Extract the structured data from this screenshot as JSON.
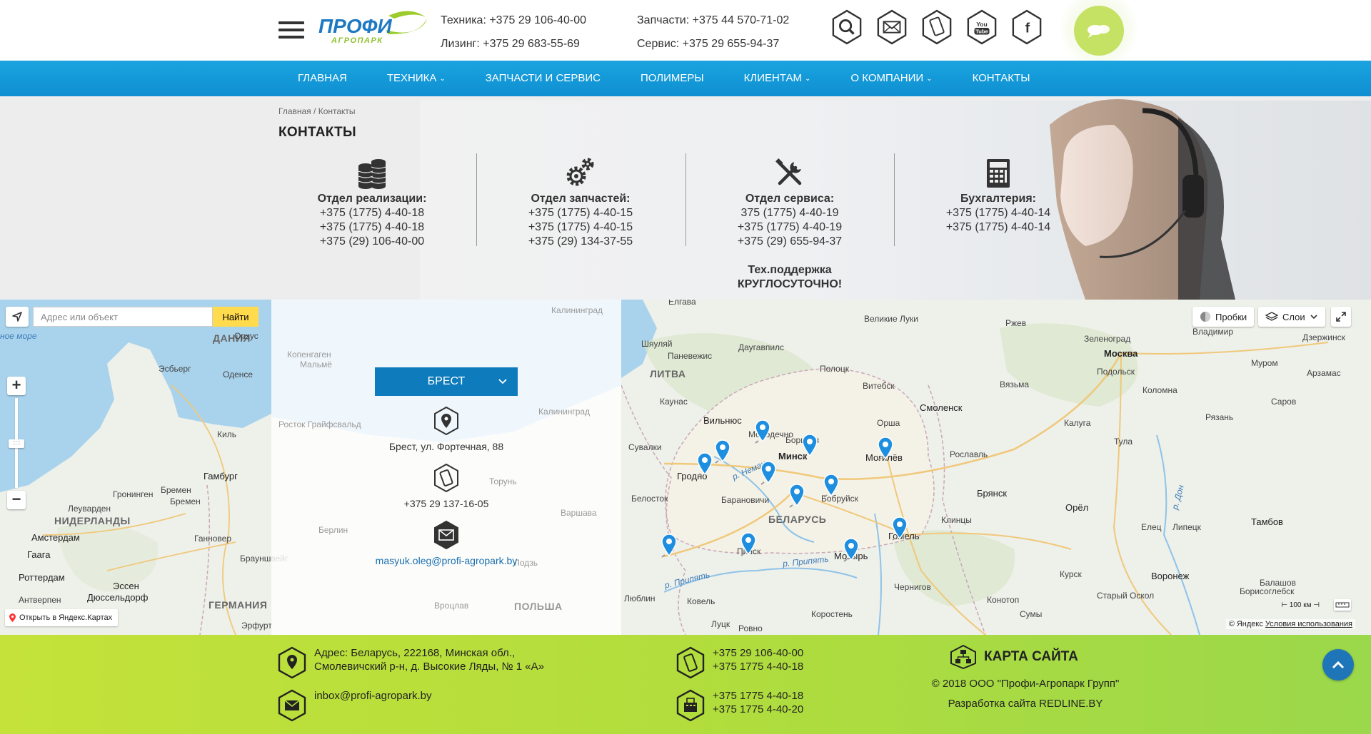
{
  "header": {
    "logo_text_top": "ПРОФИ",
    "logo_text_bottom": "АГРОПАРК",
    "phones_col1": [
      "Техника: +375 29 106-40-00",
      "Лизинг: +375 29 683-55-69"
    ],
    "phones_col2": [
      "Запчасти: +375 44 570-71-02",
      "Сервис: +375 29 655-94-37"
    ],
    "icons": [
      "search-icon",
      "mail-icon",
      "phone-icon",
      "youtube-icon",
      "facebook-icon"
    ],
    "youtube_text": "You Tube",
    "chat_icon": "chat-icon"
  },
  "nav": {
    "items": [
      {
        "label": "ГЛАВНАЯ",
        "dropdown": false
      },
      {
        "label": "ТЕХНИКА",
        "dropdown": true
      },
      {
        "label": "ЗАПЧАСТИ И СЕРВИС",
        "dropdown": false
      },
      {
        "label": "ПОЛИМЕРЫ",
        "dropdown": false
      },
      {
        "label": "КЛИЕНТАМ",
        "dropdown": true
      },
      {
        "label": "О КОМПАНИИ",
        "dropdown": true
      },
      {
        "label": "КОНТАКТЫ",
        "dropdown": false
      }
    ]
  },
  "breadcrumb": {
    "home": "Главная",
    "separator": " / ",
    "current": "Контакты"
  },
  "page_title": "КОНТАКТЫ",
  "departments": [
    {
      "icon": "coins-icon",
      "title": "Отдел реализации:",
      "phones": [
        "+375 (1775) 4-40-18",
        "+375 (1775) 4-40-18",
        "+375 (29) 106-40-00"
      ]
    },
    {
      "icon": "gears-icon",
      "title": "Отдел запчастей:",
      "phones": [
        "+375 (1775) 4-40-15",
        "+375 (1775) 4-40-15",
        "+375 (29) 134-37-55"
      ]
    },
    {
      "icon": "tools-icon",
      "title": "Отдел сервиса:",
      "phones": [
        "375 (1775) 4-40-19",
        "+375 (1775) 4-40-19",
        "+375 (29) 655-94-37"
      ],
      "extra_title": "Тех.поддержка",
      "extra_text": "КРУГЛОСУТОЧНО!"
    },
    {
      "icon": "calculator-icon",
      "title": "Бухгалтерия:",
      "phones": [
        "+375 (1775) 4-40-14",
        "+375 (1775) 4-40-14"
      ]
    }
  ],
  "map": {
    "search_placeholder": "Адрес или объект",
    "search_button": "Найти",
    "open_in_yandex": "Открыть в Яндекс.Картах",
    "traffic_button": "Пробки",
    "layers_button": "Слои",
    "scale_label": "100 км",
    "copyright": "© Яндекс",
    "terms": "Условия использования",
    "labels": {
      "sea": "ное море",
      "denmark": "ДАНИЯ",
      "orhus": "Орхус",
      "esbjerg": "Эсбьерг",
      "odense": "Оденсе",
      "copenhagen": "Копенгаген",
      "malmo": "Мальмё",
      "kiel": "Киль",
      "hamburg": "Гамбург",
      "groningen": "Гронинген",
      "bremen1": "Бремен",
      "bremen2": "Бремен",
      "leeuwarden": "Леуварден",
      "netherlands": "НИДЕРЛАНДЫ",
      "amsterdam": "Амстердам",
      "hague": "Гаага",
      "rotterdam": "Роттердам",
      "hannover": "Ганновер",
      "braunschweig": "Брауншвейг",
      "essen": "Эссен",
      "dusseldorf": "Дюссельдорф",
      "antwerp": "Антверпен",
      "germany": "ГЕРМАНИЯ",
      "erfurt": "Эрфурт",
      "kaliningrad_region": "Калининград",
      "rostock": "Росток Грайфсвальд",
      "berlin": "Берлин",
      "torun": "Торунь",
      "warsaw": "Варшава",
      "wroclaw": "Вроцлав",
      "poland": "ПОЛЬША",
      "lodz": "Лодзь",
      "elgava": "Елгава",
      "shiaulyai": "Шяуляй",
      "panevezys": "Паневежис",
      "daugavpils": "Даугавпилс",
      "lithuania": "ЛИТВА",
      "kaunas": "Каунас",
      "vilnius": "Вильнюс",
      "suvalki": "Сувалки",
      "polotsk": "Полоцк",
      "vitebsk": "Витебск",
      "velikie_luki": "Великие Луки",
      "rzhev": "Ржев",
      "zelenograd": "Зеленоград",
      "moscow": "Москва",
      "podolsk": "Подольск",
      "vladimir": "Владимир",
      "murom": "Муром",
      "dzerzhinsk": "Дзержинск",
      "arzamas": "Арзамас",
      "vyazma": "Вязьма",
      "kolomna": "Коломна",
      "sarov": "Саров",
      "ryazan": "Рязань",
      "smolensk": "Смоленск",
      "kaluga": "Калуга",
      "tula": "Тула",
      "orsha": "Орша",
      "mogilev": "Могилёв",
      "borisov": "Борисов",
      "minsk": "Минск",
      "molodechno": "Молодечно",
      "grodno": "Гродно",
      "neman": "р. Неман",
      "baranovichi": "Барановичи",
      "bobruisk": "Бобруйск",
      "belarus": "БЕЛАРУСЬ",
      "roslavl": "Рославль",
      "bryansk": "Брянск",
      "orel": "Орёл",
      "elets": "Елец",
      "lipetsk": "Липецк",
      "tambov": "Тамбов",
      "don": "р. Дон",
      "klintsy": "Клинцы",
      "gomel": "Гомель",
      "pinsk": "Пинск",
      "pripyat1": "р. Припять",
      "pripyat2": "р. Припять",
      "mozyr": "Мозырь",
      "belostok": "Белосток",
      "lublin": "Люблин",
      "kovel": "Ковель",
      "chernigov": "Чернигов",
      "kursk": "Курск",
      "voronezh": "Воронеж",
      "stary_oskol": "Старый Оскол",
      "borisoglebsk": "Борисоглебск",
      "balashov": "Балашов",
      "konotop": "Конотоп",
      "sumy": "Сумы",
      "korosten": "Коростень",
      "lutsk": "Луцк",
      "rovno": "Ровно",
      "kaliningrad": "Калининград",
      "kaliningrad_top": "Калининград"
    }
  },
  "office": {
    "selected": "БРЕСТ",
    "address": "Брест, ул. Фортечная, 88",
    "phone": "+375 29 137-16-05",
    "email": "masyuk.oleg@profi-agropark.by"
  },
  "footer": {
    "address": [
      "Адрес: Беларусь, 222168, Минская обл.,",
      "Смолевичский р-н, д. Высокие Ляды, № 1 «А»"
    ],
    "email": "inbox@profi-agropark.by",
    "mobile_phones": [
      "+375 29 106-40-00",
      "+375 1775 4-40-18"
    ],
    "landline_phones": [
      "+375 1775 4-40-18",
      "+375 1775 4-40-20"
    ],
    "sitemap": "КАРТА САЙТА",
    "copyright": "© 2018 ООО \"Профи-Агропарк Групп\"",
    "developer": "Разработка сайта REDLINE.BY"
  },
  "colors": {
    "nav": "#1aa4e0",
    "accent_green": "#c4e23a",
    "office_select": "#0e7bbd",
    "pin": "#1e8fe0",
    "search_button": "#ffdb4d"
  }
}
